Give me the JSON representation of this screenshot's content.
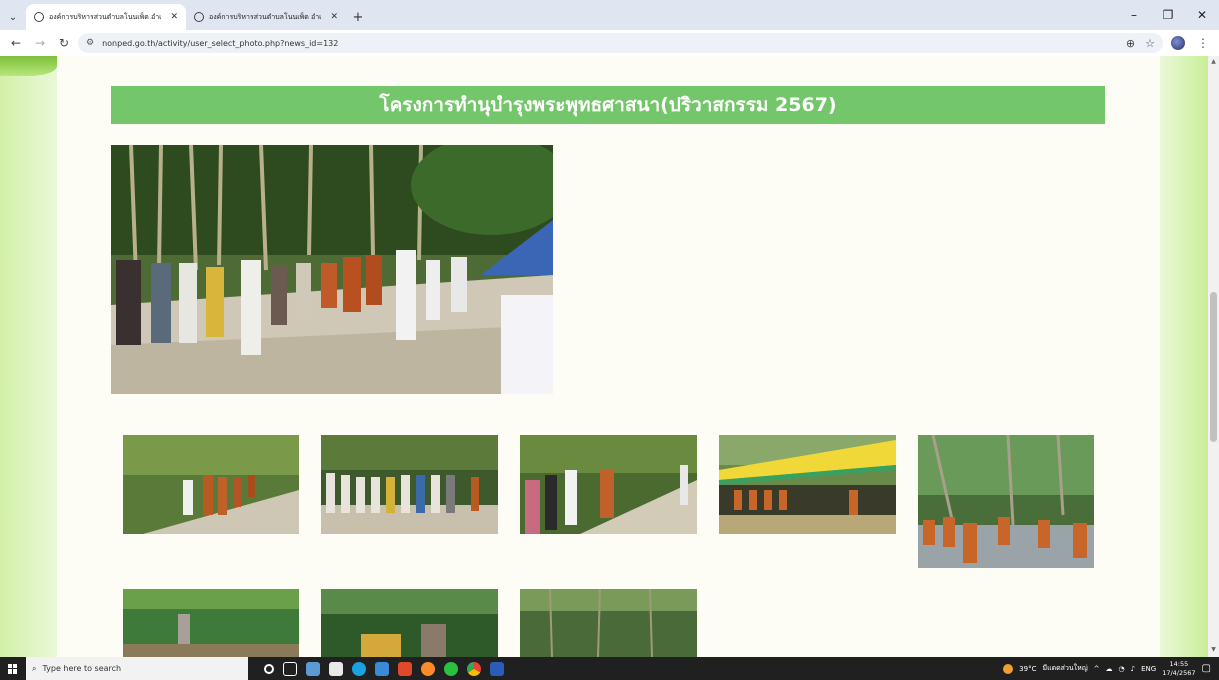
{
  "browser": {
    "tabs": [
      {
        "title": "องค์การบริหารส่วนตำบลโนนเพ็ด อำเ",
        "active": true
      },
      {
        "title": "องค์การบริหารส่วนตำบลโนนเพ็ด อำเ",
        "active": false
      }
    ],
    "new_tab": "+",
    "url": "nonped.go.th/activity/user_select_photo.php?news_id=132",
    "window_controls": {
      "minimize": "–",
      "restore": "❐",
      "close": "✕"
    }
  },
  "page": {
    "title": "โครงการทำนุบำรุงพระพุทธศาสนา(ปริวาสกรรม 2567)",
    "accent_color": "#74c66a"
  },
  "photos": {
    "main": {
      "icon": "photo-main"
    },
    "thumbnails": [
      "photo-1",
      "photo-2",
      "photo-3",
      "photo-4",
      "photo-5",
      "photo-6",
      "photo-7",
      "photo-8"
    ]
  },
  "taskbar": {
    "search_placeholder": "Type here to search",
    "weather": "39°C",
    "weather_text": "มีแดดส่วนใหญ่",
    "language": "ENG",
    "time": "14:55",
    "date": "17/4/2567"
  }
}
